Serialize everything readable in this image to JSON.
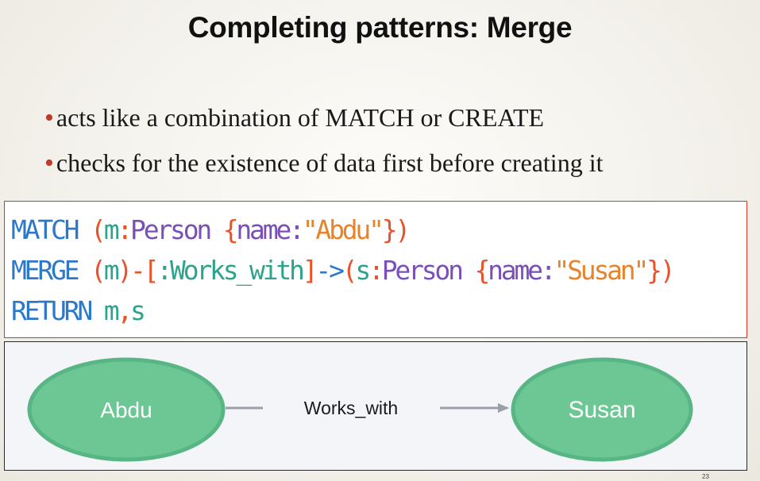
{
  "slide": {
    "title": "Completing patterns: Merge",
    "bullets": [
      "acts like a combination of MATCH or CREATE",
      "checks for the existence of data first before creating it"
    ],
    "page_number": "23"
  },
  "code": {
    "line1": {
      "keyword": "MATCH",
      "open_paren": "(",
      "var": "m",
      "colon": ":",
      "label": "Person",
      "open_brace": "{",
      "prop": "name:",
      "value": "\"Abdu\"",
      "close": "})"
    },
    "line2": {
      "keyword": "MERGE",
      "open_paren": "(",
      "var": "m",
      "close_dash": ")-",
      "rel_open": "[",
      "rel_type": ":Works_with",
      "rel_close": "]",
      "arrow": "->",
      "open_paren2": "(",
      "var2": "s",
      "colon": ":",
      "label": "Person",
      "open_brace": "{",
      "prop": "name:",
      "value": "\"Susan\"",
      "close": "})"
    },
    "line3": {
      "keyword": "RETURN",
      "var1": "m",
      "comma": ",",
      "var2": "s"
    }
  },
  "graph": {
    "source_node": "Abdu",
    "target_node": "Susan",
    "relationship": "Works_with",
    "node_color": "#6cc795",
    "node_border": "#58b684",
    "edge_color": "#9aa0a6"
  },
  "colors": {
    "keyword": "#2d78c8",
    "punctuation": "#e8532a",
    "variable": "#2da38c",
    "label": "#7b4fb8",
    "string": "#e8832a",
    "code_border": "#e0302a",
    "bullet": "#c0392b"
  }
}
